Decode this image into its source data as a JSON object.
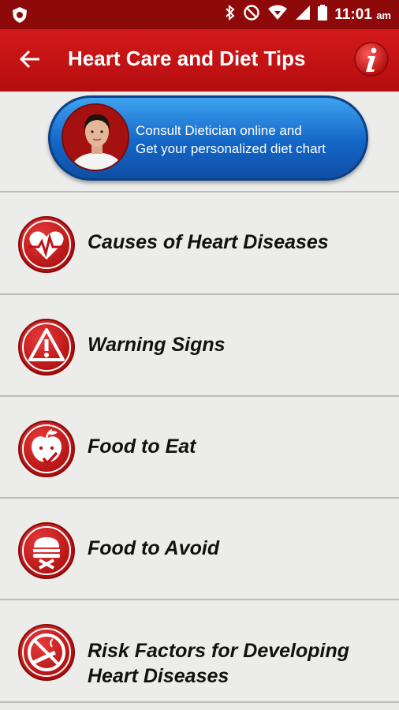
{
  "status_bar": {
    "time": "11:01",
    "ampm": "am"
  },
  "toolbar": {
    "title": "Heart Care and Diet Tips"
  },
  "banner": {
    "line1": "Consult Dietician online and",
    "line2": "Get your personalized diet chart"
  },
  "menu": {
    "items": [
      {
        "label": "Causes of Heart Diseases",
        "icon": "heartbeat-icon"
      },
      {
        "label": "Warning Signs",
        "icon": "warning-icon"
      },
      {
        "label": "Food to Eat",
        "icon": "apple-check-icon"
      },
      {
        "label": "Food to Avoid",
        "icon": "burger-cross-icon"
      },
      {
        "label_line1": "Risk Factors for Developing",
        "label_line2": "Heart Diseases",
        "icon": "no-smoking-icon"
      }
    ]
  },
  "colors": {
    "primary": "#c8141a",
    "status_bar": "#8e0a0a",
    "banner": "#1466c6",
    "background": "#ececea"
  }
}
